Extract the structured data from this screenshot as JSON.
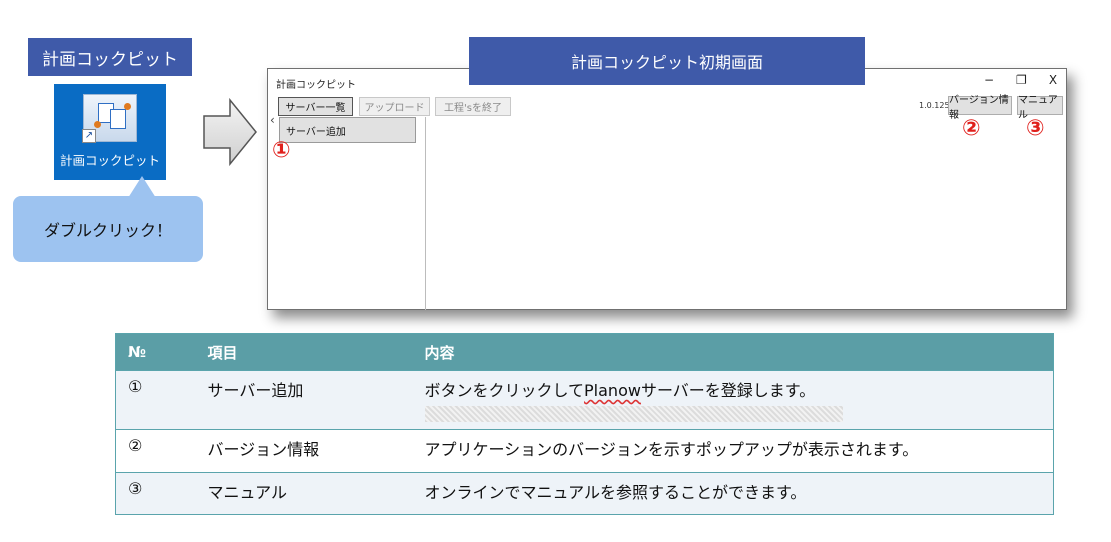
{
  "left_panel": {
    "app_label": "計画コックピット",
    "desktop_icon_caption": "計画コックピット",
    "bubble_text": "ダブルクリック！"
  },
  "screen_title": "計画コックピット初期画面",
  "window": {
    "title": "計画コックピット",
    "controls": {
      "minimize": "−",
      "restore": "❐",
      "close": "X"
    },
    "toolbar": {
      "server_list": "サーバー一覧",
      "upload": "アップロード",
      "finish_process": "工程'sを終了"
    },
    "version": "1.0.125.0",
    "version_info_button": "バージョン情報",
    "manual_button": "マニュアル",
    "collapse_chevron": "‹",
    "server_add_button": "サーバー追加"
  },
  "markers": {
    "m1": "①",
    "m2": "②",
    "m3": "③"
  },
  "table": {
    "headers": {
      "no": "№",
      "item": "項目",
      "content": "内容"
    },
    "rows": [
      {
        "no": "①",
        "item": "サーバー追加",
        "content_pre": "ボタンをクリックして",
        "content_word": "Planow",
        "content_post": "サーバーを登録します。"
      },
      {
        "no": "②",
        "item": "バージョン情報",
        "content": "アプリケーションのバージョンを示すポップアップが表示されます。"
      },
      {
        "no": "③",
        "item": "マニュアル",
        "content": "オンラインでマニュアルを参照することができます。"
      }
    ]
  },
  "colors": {
    "banner": "#3f5aa9",
    "icon_bg": "#0a6cc4",
    "bubble": "#9dc3f0",
    "table_header": "#5b9ea6",
    "marker": "#e0201c"
  }
}
